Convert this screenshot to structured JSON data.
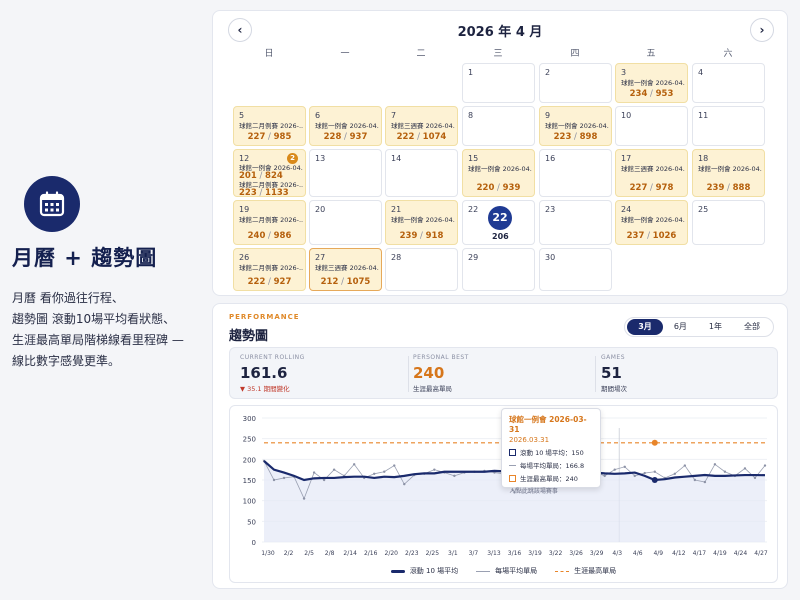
{
  "promo": {
    "title": "月曆 + 趨勢圖",
    "lines": [
      "月曆 看你過往行程、",
      "趨勢圖 滾動10場平均看狀態、",
      "生涯最高單局階梯線看里程碑 —",
      "線比數字感覺更準。"
    ],
    "icon": "calendar-icon",
    "icon_bg": "#1a2a6c"
  },
  "calendar": {
    "title": "2026 年 4 月",
    "prev_icon": "chevron-left-icon",
    "next_icon": "chevron-right-icon",
    "weekdays": [
      "日",
      "一",
      "二",
      "三",
      "四",
      "五",
      "六"
    ],
    "today": "22",
    "today_score": "206",
    "rows": [
      [
        {
          "day": "",
          "blank": true
        },
        {
          "day": "",
          "blank": true
        },
        {
          "day": "",
          "blank": true
        },
        {
          "day": "1"
        },
        {
          "day": "2"
        },
        {
          "day": "3",
          "events": [
            "球館一例會 2026-04..."
          ],
          "score": "234",
          "score2": "953"
        },
        {
          "day": "4"
        }
      ],
      [
        {
          "day": "5",
          "events": [
            "球館二月例賽 2026-..."
          ],
          "score": "227",
          "score2": "985"
        },
        {
          "day": "6",
          "events": [
            "球館一例會 2026-04..."
          ],
          "score": "228",
          "score2": "937"
        },
        {
          "day": "7",
          "events": [
            "球館三週賽 2026-04..."
          ],
          "score": "222",
          "score2": "1074"
        },
        {
          "day": "8"
        },
        {
          "day": "9",
          "events": [
            "球館一例會 2026-04..."
          ],
          "score": "223",
          "score2": "898"
        },
        {
          "day": "10"
        },
        {
          "day": "11"
        }
      ],
      [
        {
          "day": "12",
          "badge": "2",
          "events": [
            "球館一例會 2026-04...",
            "球館二月例賽 2026-..."
          ],
          "score": "201",
          "score2": "824",
          "score_b": "223",
          "score2_b": "1133"
        },
        {
          "day": "13"
        },
        {
          "day": "14"
        },
        {
          "day": "15",
          "events": [
            "球館一例會 2026-04..."
          ],
          "score": "220",
          "score2": "939"
        },
        {
          "day": "16"
        },
        {
          "day": "17",
          "events": [
            "球館三週賽 2026-04..."
          ],
          "score": "227",
          "score2": "978"
        },
        {
          "day": "18",
          "events": [
            "球館一例會 2026-04..."
          ],
          "score": "239",
          "score2": "888"
        }
      ],
      [
        {
          "day": "19",
          "events": [
            "球館二月例賽 2026-..."
          ],
          "score": "240",
          "score2": "986"
        },
        {
          "day": "20"
        },
        {
          "day": "21",
          "events": [
            "球館一例會 2026-04..."
          ],
          "score": "239",
          "score2": "918"
        },
        {
          "day": "22",
          "today": true
        },
        {
          "day": "23"
        },
        {
          "day": "24",
          "events": [
            "球館一例會 2026-04..."
          ],
          "score": "237",
          "score2": "1026"
        },
        {
          "day": "25"
        }
      ],
      [
        {
          "day": "26",
          "events": [
            "球館二月例賽 2026-..."
          ],
          "score": "222",
          "score2": "927"
        },
        {
          "day": "27",
          "selected": true,
          "events": [
            "球館三週賽 2026-04..."
          ],
          "score": "212",
          "score2": "1075"
        },
        {
          "day": "28"
        },
        {
          "day": "29"
        },
        {
          "day": "30"
        },
        {
          "day": "",
          "blank": true
        },
        {
          "day": "",
          "blank": true
        }
      ]
    ]
  },
  "trend": {
    "section_label": "PERFORMANCE",
    "title": "趨勢圖",
    "ranges": [
      "3月",
      "6月",
      "1年",
      "全部"
    ],
    "active_range": "3月",
    "stats": {
      "current_label": "CURRENT ROLLING",
      "current_value": "161.6",
      "current_sub": "▼ 35.1 期間變化",
      "best_label": "PERSONAL BEST",
      "best_value": "240",
      "best_sub": "生涯最高單局",
      "games_label": "GAMES",
      "games_value": "51",
      "games_sub": "期間場次"
    },
    "tooltip": {
      "title": "球館一例會 2026-03-31",
      "date": "2026.03.31",
      "row1": "滾動 10 場平均：150",
      "row2": "每場平均單局：166.8",
      "row3": "生涯最高單局：240",
      "hint": "↗ 點此跳該場賽事"
    },
    "legend": [
      "滾動 10 場平均",
      "每場平均單局",
      "生涯最高單局"
    ],
    "colors": {
      "rolling": "#1a2a6c",
      "per_game": "#9aa0b2",
      "best": "#e8852a",
      "fill": "#e4e8f6"
    }
  },
  "chart_data": {
    "type": "line",
    "ylim": [
      0,
      300
    ],
    "yticks": [
      "300",
      "250",
      "200",
      "150",
      "100",
      "50",
      "0"
    ],
    "xticks": [
      "1/30",
      "2/2",
      "2/5",
      "2/8",
      "2/14",
      "2/16",
      "2/20",
      "2/23",
      "2/25",
      "3/1",
      "3/7",
      "3/13",
      "3/16",
      "3/19",
      "3/22",
      "3/26",
      "3/29",
      "4/3",
      "4/6",
      "4/9",
      "4/12",
      "4/17",
      "4/19",
      "4/24",
      "4/27"
    ],
    "highlight_tick": "4/3",
    "series": [
      {
        "name": "滾動 10 場平均",
        "values": [
          196,
          175,
          168,
          160,
          150,
          154,
          155,
          155,
          157,
          158,
          158,
          155,
          158,
          157,
          160,
          164,
          166,
          166,
          170,
          170,
          170,
          170,
          170,
          172,
          171,
          172,
          172,
          170,
          171,
          170,
          170,
          170,
          168,
          168,
          166,
          165,
          166,
          168,
          160,
          150,
          152,
          156,
          158,
          160,
          162,
          160,
          160,
          161,
          162,
          162,
          161.6
        ]
      },
      {
        "name": "每場平均單局",
        "values": [
          196,
          150,
          155,
          158,
          105,
          168,
          150,
          175,
          160,
          188,
          155,
          165,
          170,
          185,
          140,
          162,
          165,
          175,
          168,
          160,
          168,
          170,
          172,
          168,
          165,
          120,
          185,
          175,
          172,
          158,
          170,
          168,
          165,
          170,
          160,
          175,
          182,
          160,
          166.8,
          170,
          155,
          165,
          185,
          150,
          145,
          188,
          170,
          160,
          178,
          155,
          185
        ]
      },
      {
        "name": "生涯最高單局",
        "values": [
          240,
          240,
          240,
          240,
          240,
          240,
          240,
          240,
          240,
          240,
          240,
          240,
          240,
          240,
          240,
          240,
          240,
          240,
          240,
          240,
          240,
          240,
          240,
          240,
          240,
          240,
          240,
          240,
          240,
          240,
          240,
          240,
          240,
          240,
          240,
          240,
          240,
          240,
          240,
          240,
          240,
          240,
          240,
          240,
          240,
          240,
          240,
          240,
          240,
          240,
          240
        ]
      }
    ]
  }
}
